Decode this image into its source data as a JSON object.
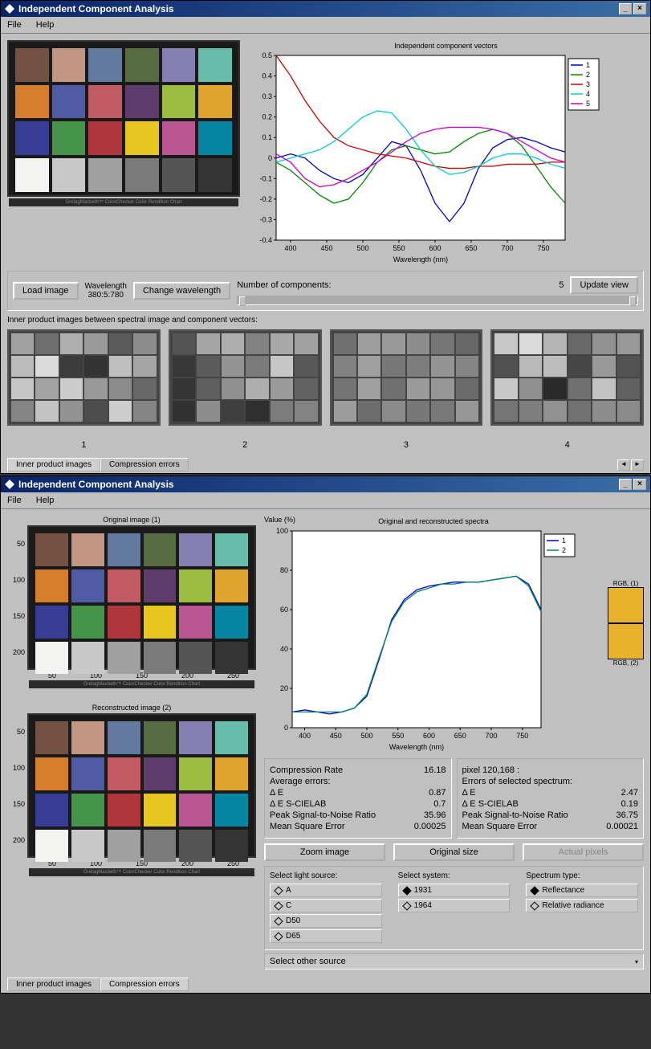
{
  "window1": {
    "title": "Independent Component Analysis",
    "menu": {
      "file": "File",
      "help": "Help"
    },
    "controls": {
      "load_image": "Load image",
      "wavelength_label": "Wavelength",
      "wavelength_value": "380:5:780",
      "change_wavelength": "Change wavelength",
      "num_components_label": "Number of components:",
      "num_components_value": "5",
      "update_view": "Update view"
    },
    "inner_product_label": "Inner product images between spectral image and component vectors:",
    "thumb_labels": [
      "1",
      "2",
      "3",
      "4"
    ],
    "tabs": {
      "tab1": "Inner product images",
      "tab2": "Compression errors"
    },
    "colorchecker_footer": "GretagMacbeth™ ColorChecker Color Rendition Chart",
    "cc_colors": [
      "#735244",
      "#c29682",
      "#627a9d",
      "#576c43",
      "#8580b1",
      "#67bdaa",
      "#d67e2c",
      "#505ba6",
      "#c15a63",
      "#5e3c6c",
      "#9dbc40",
      "#e0a32e",
      "#383d96",
      "#469449",
      "#af363c",
      "#e7c71f",
      "#bb5695",
      "#0885a1",
      "#f3f3f2",
      "#c8c8c8",
      "#a0a0a0",
      "#7a7a7a",
      "#555555",
      "#343434"
    ]
  },
  "window2": {
    "title": "Independent Component Analysis",
    "menu": {
      "file": "File",
      "help": "Help"
    },
    "img_titles": {
      "original": "Original image (1)",
      "reconstructed": "Reconstructed image (2)"
    },
    "img_y_ticks": [
      "50",
      "100",
      "150",
      "200"
    ],
    "img_x_ticks": [
      "50",
      "100",
      "150",
      "200",
      "250"
    ],
    "rgb_label1": "RGB, (1)",
    "rgb_label2": "RGB, (2)",
    "rgb_color": "#e8b22c",
    "stats_left": {
      "compression_rate_label": "Compression Rate",
      "compression_rate_value": "16.18",
      "avg_errors": "Average errors:",
      "de_label": "Δ E",
      "de_value": "0.87",
      "de_scielab_label": "Δ E S-CIELAB",
      "de_scielab_value": "0.7",
      "psnr_label": "Peak Signal-to-Noise Ratio",
      "psnr_value": "35.96",
      "mse_label": "Mean Square Error",
      "mse_value": "0.00025"
    },
    "stats_right": {
      "pixel_label": "pixel 120,168 :",
      "avg_errors": "Errors of selected spectrum:",
      "de_label": "Δ E",
      "de_value": "2.47",
      "de_scielab_label": "Δ E S-CIELAB",
      "de_scielab_value": "0.19",
      "psnr_label": "Peak Signal-to-Noise Ratio",
      "psnr_value": "36.75",
      "mse_label": "Mean Square Error",
      "mse_value": "0.00021"
    },
    "buttons": {
      "zoom": "Zoom image",
      "original_size": "Original size",
      "actual_pixels": "Actual pixels"
    },
    "select_labels": {
      "light": "Select light source:",
      "system": "Select system:",
      "spectrum": "Spectrum type:"
    },
    "light_sources": [
      "A",
      "C",
      "D50",
      "D65"
    ],
    "systems": [
      "1931",
      "1964"
    ],
    "spectrum_types": [
      "Reflectance",
      "Relative radiance"
    ],
    "select_other": "Select other source",
    "tabs": {
      "tab1": "Inner product images",
      "tab2": "Compression errors"
    }
  },
  "chart_data": [
    {
      "type": "line",
      "title": "Independent component vectors",
      "xlabel": "Wavelength (nm)",
      "ylabel": "",
      "xlim": [
        380,
        780
      ],
      "ylim": [
        -0.4,
        0.5
      ],
      "x_ticks": [
        400,
        450,
        500,
        550,
        600,
        650,
        700,
        750
      ],
      "y_ticks": [
        -0.4,
        -0.3,
        -0.2,
        -0.1,
        0,
        0.1,
        0.2,
        0.3,
        0.4,
        0.5
      ],
      "x": [
        380,
        400,
        420,
        440,
        460,
        480,
        500,
        520,
        540,
        560,
        580,
        600,
        620,
        640,
        660,
        680,
        700,
        720,
        740,
        760,
        780
      ],
      "series": [
        {
          "name": "1",
          "color": "#0000cc",
          "values": [
            0.0,
            0.02,
            0.0,
            -0.06,
            -0.1,
            -0.12,
            -0.08,
            0.0,
            0.08,
            0.06,
            -0.06,
            -0.22,
            -0.31,
            -0.22,
            -0.05,
            0.05,
            0.09,
            0.1,
            0.08,
            0.05,
            0.03
          ]
        },
        {
          "name": "2",
          "color": "#008800",
          "values": [
            -0.02,
            -0.06,
            -0.12,
            -0.18,
            -0.22,
            -0.2,
            -0.12,
            -0.02,
            0.04,
            0.06,
            0.04,
            0.02,
            0.03,
            0.08,
            0.12,
            0.14,
            0.12,
            0.06,
            -0.04,
            -0.14,
            -0.22
          ]
        },
        {
          "name": "3",
          "color": "#cc0000",
          "values": [
            0.5,
            0.4,
            0.28,
            0.18,
            0.1,
            0.06,
            0.04,
            0.02,
            0.01,
            0.0,
            -0.02,
            -0.04,
            -0.05,
            -0.05,
            -0.04,
            -0.04,
            -0.03,
            -0.03,
            -0.03,
            -0.02,
            -0.02
          ]
        },
        {
          "name": "4",
          "color": "#00cccc",
          "values": [
            -0.02,
            0.0,
            0.02,
            0.04,
            0.08,
            0.14,
            0.2,
            0.23,
            0.22,
            0.14,
            0.04,
            -0.04,
            -0.08,
            -0.07,
            -0.04,
            0.0,
            0.02,
            0.02,
            0.0,
            -0.03,
            -0.05
          ]
        },
        {
          "name": "5",
          "color": "#cc00cc",
          "values": [
            0.02,
            -0.02,
            -0.1,
            -0.14,
            -0.13,
            -0.1,
            -0.06,
            -0.02,
            0.03,
            0.08,
            0.12,
            0.14,
            0.15,
            0.15,
            0.15,
            0.14,
            0.12,
            0.08,
            0.04,
            0.0,
            -0.02
          ]
        }
      ],
      "legend": [
        "1",
        "2",
        "3",
        "4",
        "5"
      ]
    },
    {
      "type": "line",
      "title": "Original and reconstructed spectra",
      "xlabel": "Wavelength (nm)",
      "ylabel": "Value (%)",
      "xlim": [
        380,
        780
      ],
      "ylim": [
        0,
        100
      ],
      "x_ticks": [
        400,
        450,
        500,
        550,
        600,
        650,
        700,
        750
      ],
      "y_ticks": [
        0,
        20,
        40,
        60,
        80,
        100
      ],
      "x": [
        380,
        400,
        420,
        440,
        460,
        480,
        500,
        520,
        540,
        560,
        580,
        600,
        620,
        640,
        660,
        680,
        700,
        720,
        740,
        760,
        780
      ],
      "series": [
        {
          "name": "1",
          "color": "#0000cc",
          "values": [
            8,
            9,
            8,
            7,
            8,
            10,
            16,
            35,
            55,
            65,
            70,
            72,
            73,
            74,
            74,
            74,
            75,
            76,
            77,
            73,
            60
          ]
        },
        {
          "name": "2",
          "color": "#008866",
          "values": [
            8,
            8,
            8,
            8,
            8,
            10,
            17,
            36,
            54,
            64,
            69,
            71,
            73,
            73,
            74,
            74,
            75,
            76,
            77,
            72,
            59
          ]
        }
      ],
      "legend": [
        "1",
        "2"
      ]
    }
  ]
}
